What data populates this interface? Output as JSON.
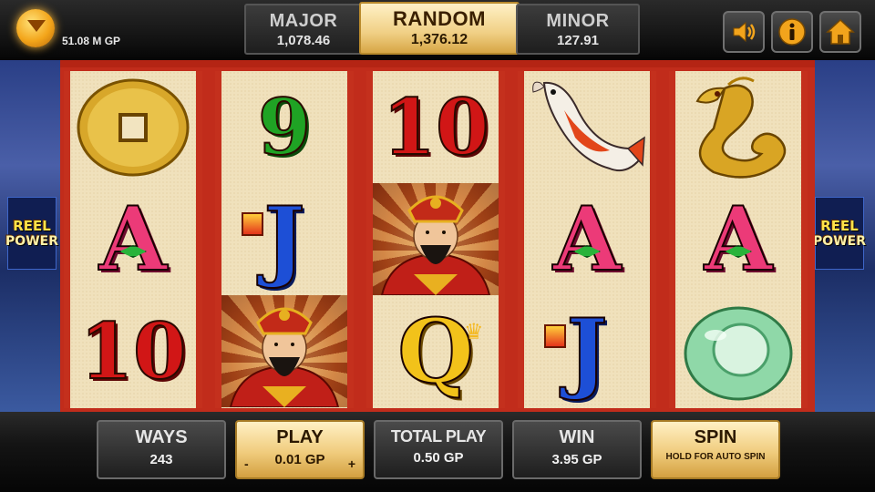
{
  "balance": {
    "amount": "51.08 M GP",
    "icon": "gold-coin-icon"
  },
  "jackpots": {
    "major": {
      "title": "MAJOR",
      "value": "1,078.46"
    },
    "random": {
      "title": "RANDOM",
      "value": "1,376.12"
    },
    "minor": {
      "title": "MINOR",
      "value": "127.91"
    }
  },
  "top_buttons": [
    "sound-icon",
    "info-icon",
    "home-icon"
  ],
  "side_logo": {
    "line1": "REEL",
    "line2": "POWER"
  },
  "reels": [
    [
      "coin",
      "A",
      "10"
    ],
    [
      "9",
      "J",
      "fortune-god"
    ],
    [
      "10",
      "fortune-god",
      "Q"
    ],
    [
      "koi-fish",
      "A",
      "J"
    ],
    [
      "golden-dragon",
      "A",
      "jade-ring"
    ]
  ],
  "symbols": {
    "ten": "10",
    "nine": "9",
    "ace": "A",
    "jack": "J",
    "queen": "Q"
  },
  "bottom": {
    "ways": {
      "title": "WAYS",
      "value": "243"
    },
    "play": {
      "title": "PLAY",
      "value": "0.01 GP",
      "minus": "-",
      "plus": "+"
    },
    "total_play": {
      "title": "TOTAL PLAY",
      "value": "0.50 GP"
    },
    "win": {
      "title": "WIN",
      "value": "3.95 GP"
    },
    "spin": {
      "title": "SPIN",
      "sub": "HOLD FOR AUTO SPIN"
    }
  },
  "colors": {
    "reel_frame": "#c4301d",
    "reel_bg": "#f0e1bc",
    "gold_button": "#f0cc7d",
    "accent_yellow": "#ffe24a"
  }
}
